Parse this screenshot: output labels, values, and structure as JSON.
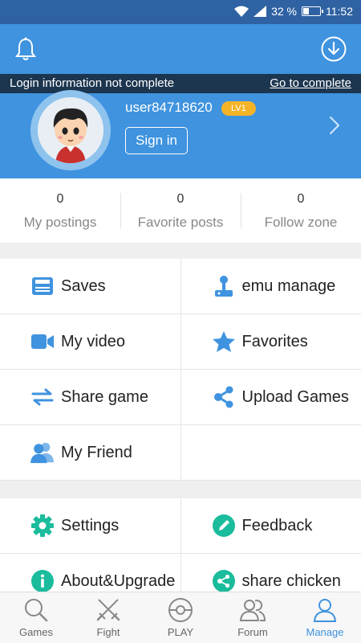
{
  "status_bar": {
    "battery": "32 %",
    "time": "11:52"
  },
  "header": {
    "login_banner": {
      "message": "Login information not complete",
      "link": "Go to complete"
    },
    "username": "user84718620",
    "level": "LV1",
    "sign_in": "Sign in"
  },
  "stats": [
    {
      "value": "0",
      "label": "My postings"
    },
    {
      "value": "0",
      "label": "Favorite posts"
    },
    {
      "value": "0",
      "label": "Follow zone"
    }
  ],
  "menu": {
    "saves": "Saves",
    "emu_manage": "emu manage",
    "my_video": "My video",
    "favorites": "Favorites",
    "share_game": "Share game",
    "upload_games": "Upload Games",
    "my_friend": "My Friend",
    "settings": "Settings",
    "feedback": "Feedback",
    "about": "About&Upgrade",
    "share_chicken": "share chicken"
  },
  "tabs": [
    "Games",
    "Fight",
    "PLAY",
    "Forum",
    "Manage"
  ],
  "active_tab": "Manage",
  "colors": {
    "primary": "#3f93df",
    "status_bar": "#2f62a3",
    "banner": "#1d3650",
    "badge": "#f5b427",
    "icon_teal": "#1abc9c"
  }
}
